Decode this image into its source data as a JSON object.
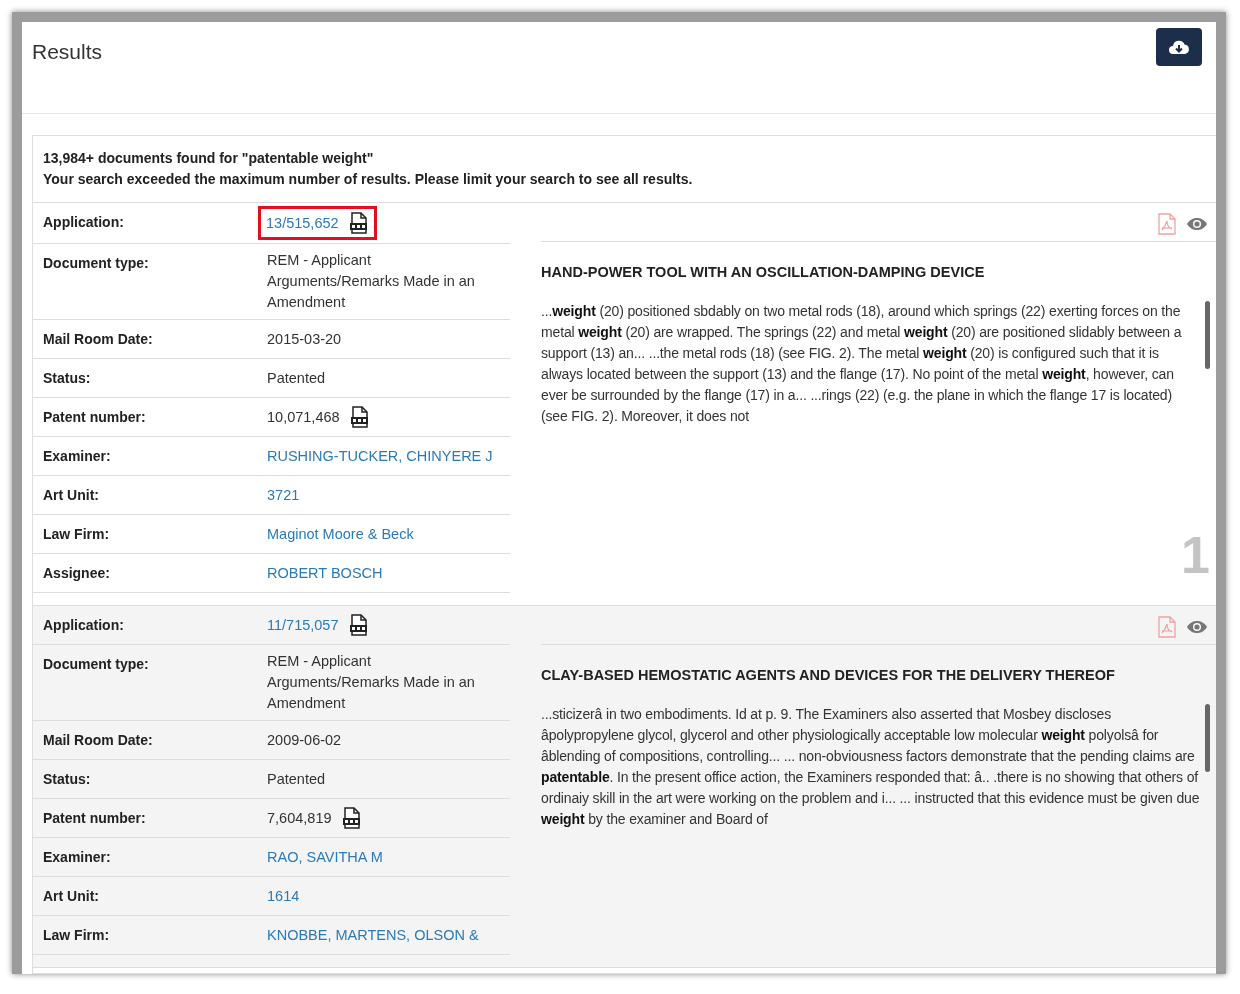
{
  "header": {
    "title": "Results"
  },
  "summary": {
    "count_line": "13,984+ documents found for \"patentable weight\"",
    "notice": "Your search exceeded the maximum number of results. Please limit your search to see all results."
  },
  "results": [
    {
      "rank": "1",
      "title": "HAND-POWER TOOL WITH AN OSCILLATION-DAMPING DEVICE",
      "snippet": "...**weight** (20) positioned sbdably on two metal rods (18), around which springs (22) exerting forces on the metal **weight** (20) are wrapped. The springs (22) and metal **weight** (20) are positioned slidably between a support (13) an... ...the metal rods (18) (see FIG. 2). The metal **weight** (20) is configured such that it is always located between the support (13) and the flange (17). No point of the metal **weight**, however, can ever be surrounded by the flange (17) in a... ...rings (22) (e.g. the plane in which the flange 17 is located) (see FIG. 2). Moreover, it does not",
      "fields": [
        {
          "label": "Application:",
          "value": "13/515,652",
          "kind": "link",
          "pdf": true,
          "highlighted": true
        },
        {
          "label": "Document type:",
          "value": "REM - Applicant Arguments/Remarks Made in an Amendment",
          "kind": "text",
          "pdf": false,
          "highlighted": false
        },
        {
          "label": "Mail Room Date:",
          "value": "2015-03-20",
          "kind": "text",
          "pdf": false,
          "highlighted": false
        },
        {
          "label": "Status:",
          "value": "Patented",
          "kind": "text",
          "pdf": false,
          "highlighted": false
        },
        {
          "label": "Patent number:",
          "value": "10,071,468",
          "kind": "text",
          "pdf": true,
          "highlighted": false
        },
        {
          "label": "Examiner:",
          "value": "RUSHING-TUCKER, CHINYERE J",
          "kind": "link",
          "pdf": false,
          "highlighted": false
        },
        {
          "label": "Art Unit:",
          "value": "3721",
          "kind": "link",
          "pdf": false,
          "highlighted": false
        },
        {
          "label": "Law Firm:",
          "value": "Maginot Moore & Beck",
          "kind": "link",
          "pdf": false,
          "highlighted": false
        },
        {
          "label": "Assignee:",
          "value": "ROBERT BOSCH",
          "kind": "link",
          "pdf": false,
          "highlighted": false
        }
      ]
    },
    {
      "title": "CLAY-BASED HEMOSTATIC AGENTS AND DEVICES FOR THE DELIVERY THEREOF",
      "snippet": "...sticizerâ in two embodiments. Id at p. 9. The Examiners also asserted that Mosbey discloses âpolypropylene glycol, glycerol and other physiologically acceptable low molecular **weight** polyolsâ for âblending of compositions, controlling... ... non-obviousness factors demonstrate that the pending claims are **patentable**. In the present office action, the Examiners responded that: â.. .there is no showing that others of ordinaiy skill in the art were working on the problem and i... ... instructed that this evidence must be given due **weight** by the examiner and Board of",
      "fields": [
        {
          "label": "Application:",
          "value": "11/715,057",
          "kind": "link",
          "pdf": true,
          "highlighted": false
        },
        {
          "label": "Document type:",
          "value": "REM - Applicant Arguments/Remarks Made in an Amendment",
          "kind": "text",
          "pdf": false,
          "highlighted": false
        },
        {
          "label": "Mail Room Date:",
          "value": "2009-06-02",
          "kind": "text",
          "pdf": false,
          "highlighted": false
        },
        {
          "label": "Status:",
          "value": "Patented",
          "kind": "text",
          "pdf": false,
          "highlighted": false
        },
        {
          "label": "Patent number:",
          "value": "7,604,819",
          "kind": "text",
          "pdf": true,
          "highlighted": false
        },
        {
          "label": "Examiner:",
          "value": "RAO, SAVITHA M",
          "kind": "link",
          "pdf": false,
          "highlighted": false
        },
        {
          "label": "Art Unit:",
          "value": "1614",
          "kind": "link",
          "pdf": false,
          "highlighted": false
        },
        {
          "label": "Law Firm:",
          "value": "KNOBBE, MARTENS, OLSON &",
          "kind": "link",
          "pdf": false,
          "highlighted": false
        }
      ]
    }
  ]
}
